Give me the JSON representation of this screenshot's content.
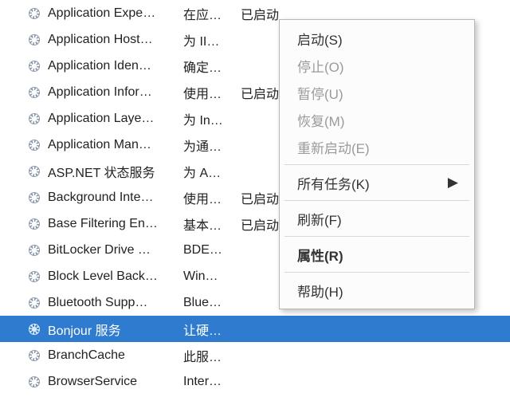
{
  "colors": {
    "selection": "#2f7bd0"
  },
  "services": [
    {
      "name": "Application Expe…",
      "desc": "在应…",
      "status": "已启动"
    },
    {
      "name": "Application Host…",
      "desc": "为 II…",
      "status": ""
    },
    {
      "name": "Application Iden…",
      "desc": "确定…",
      "status": ""
    },
    {
      "name": "Application Infor…",
      "desc": "使用…",
      "status": "已启动"
    },
    {
      "name": "Application Laye…",
      "desc": "为 In…",
      "status": ""
    },
    {
      "name": "Application Man…",
      "desc": "为通…",
      "status": ""
    },
    {
      "name": "ASP.NET 状态服务",
      "desc": "为 A…",
      "status": ""
    },
    {
      "name": "Background Inte…",
      "desc": "使用…",
      "status": "已启动"
    },
    {
      "name": "Base Filtering En…",
      "desc": "基本…",
      "status": "已启动"
    },
    {
      "name": "BitLocker Drive …",
      "desc": "BDE…",
      "status": ""
    },
    {
      "name": "Block Level Back…",
      "desc": "Win…",
      "status": ""
    },
    {
      "name": "Bluetooth Supp…",
      "desc": "Blue…",
      "status": ""
    },
    {
      "name": "Bonjour 服务",
      "desc": "让硬…",
      "status": ""
    },
    {
      "name": "BranchCache",
      "desc": "此服…",
      "status": ""
    },
    {
      "name": "BrowserService",
      "desc": "Inter…",
      "status": ""
    }
  ],
  "selected_index": 12,
  "menu": {
    "start": "启动(S)",
    "stop": "停止(O)",
    "pause": "暂停(U)",
    "resume": "恢复(M)",
    "restart": "重新启动(E)",
    "alltasks": "所有任务(K)",
    "refresh": "刷新(F)",
    "props": "属性(R)",
    "help": "帮助(H)",
    "arrow": "▶"
  }
}
